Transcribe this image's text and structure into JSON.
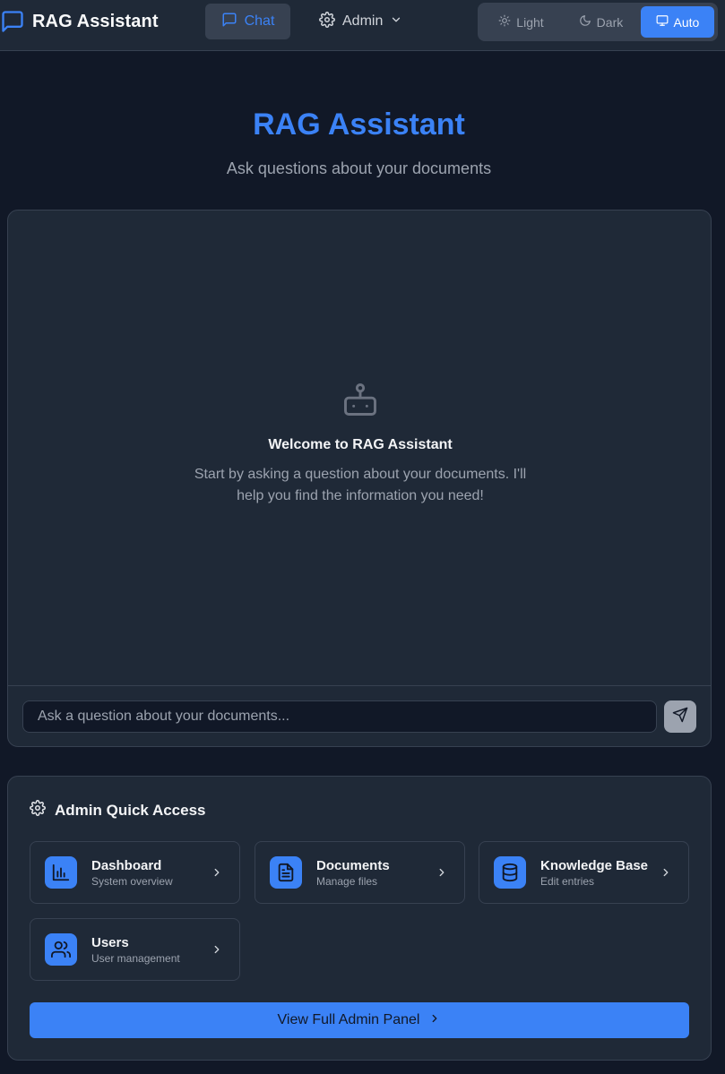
{
  "app": {
    "title": "RAG Assistant"
  },
  "nav": {
    "chat_label": "Chat",
    "admin_label": "Admin"
  },
  "theme": {
    "options": [
      {
        "label": "Light",
        "selected": false
      },
      {
        "label": "Dark",
        "selected": false
      },
      {
        "label": "Auto",
        "selected": true
      }
    ]
  },
  "hero": {
    "title": "RAG Assistant",
    "subtitle": "Ask questions about your documents"
  },
  "chat": {
    "welcome_title": "Welcome to RAG Assistant",
    "welcome_text": "Start by asking a question about your documents. I'll help you find the information you need!",
    "input_placeholder": "Ask a question about your documents..."
  },
  "admin_quick": {
    "title": "Admin Quick Access",
    "cards": [
      {
        "title": "Dashboard",
        "subtitle": "System overview",
        "icon": "bar-chart-icon"
      },
      {
        "title": "Documents",
        "subtitle": "Manage files",
        "icon": "file-text-icon"
      },
      {
        "title": "Knowledge Base",
        "subtitle": "Edit entries",
        "icon": "database-icon"
      },
      {
        "title": "Users",
        "subtitle": "User management",
        "icon": "users-icon"
      }
    ],
    "view_all_label": "View Full Admin Panel"
  },
  "colors": {
    "accent": "#3b82f6",
    "background": "#111827",
    "panel": "#1f2937",
    "border": "#374151",
    "muted_text": "#9ca3af"
  }
}
